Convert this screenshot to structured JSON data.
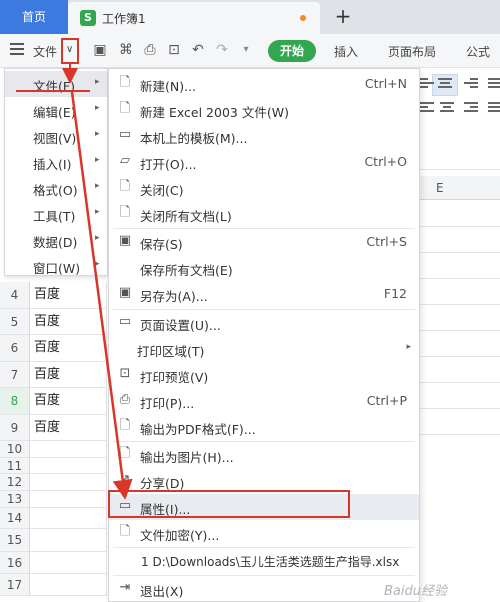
{
  "tabs": {
    "home": "首页",
    "document": "工作簿1",
    "add": "+"
  },
  "toolbar": {
    "file": "文件",
    "start": "开始",
    "insert": "插入",
    "page_layout": "页面布局",
    "formula": "公式"
  },
  "grid": {
    "column_e": "E",
    "rows": [
      {
        "num": "4",
        "value": "百度"
      },
      {
        "num": "5",
        "value": "百度"
      },
      {
        "num": "6",
        "value": "百度"
      },
      {
        "num": "7",
        "value": "百度"
      },
      {
        "num": "8",
        "value": "百度"
      },
      {
        "num": "9",
        "value": "百度"
      },
      {
        "num": "10",
        "value": ""
      },
      {
        "num": "11",
        "value": ""
      },
      {
        "num": "12",
        "value": ""
      },
      {
        "num": "13",
        "value": ""
      },
      {
        "num": "14",
        "value": ""
      },
      {
        "num": "15",
        "value": ""
      },
      {
        "num": "16",
        "value": ""
      },
      {
        "num": "17",
        "value": ""
      }
    ]
  },
  "left_menu": [
    {
      "label": "文件(F)"
    },
    {
      "label": "编辑(E)"
    },
    {
      "label": "视图(V)"
    },
    {
      "label": "插入(I)"
    },
    {
      "label": "格式(O)"
    },
    {
      "label": "工具(T)"
    },
    {
      "label": "数据(D)"
    },
    {
      "label": "窗口(W)"
    }
  ],
  "file_menu": [
    {
      "label": "新建(N)...",
      "shortcut": "Ctrl+N",
      "icon": "new-doc-icon"
    },
    {
      "label": "新建 Excel 2003 文件(W)",
      "shortcut": "",
      "icon": "new-excel-icon"
    },
    {
      "label": "本机上的模板(M)...",
      "shortcut": "",
      "icon": "template-icon"
    },
    {
      "label": "打开(O)...",
      "shortcut": "Ctrl+O",
      "icon": "folder-icon"
    },
    {
      "label": "关闭(C)",
      "shortcut": "",
      "icon": "close-doc-icon"
    },
    {
      "label": "关闭所有文档(L)",
      "shortcut": "",
      "icon": "close-all-icon"
    },
    {
      "label": "保存(S)",
      "shortcut": "Ctrl+S",
      "icon": "save-icon"
    },
    {
      "label": "保存所有文档(E)",
      "shortcut": "",
      "icon": ""
    },
    {
      "label": "另存为(A)...",
      "shortcut": "F12",
      "icon": "save-as-icon"
    },
    {
      "label": "页面设置(U)...",
      "shortcut": "",
      "icon": "page-setup-icon"
    },
    {
      "label": "打印区域(T)",
      "shortcut": "",
      "icon": ""
    },
    {
      "label": "打印预览(V)",
      "shortcut": "",
      "icon": "print-preview-icon"
    },
    {
      "label": "打印(P)...",
      "shortcut": "Ctrl+P",
      "icon": "printer-icon"
    },
    {
      "label": "输出为PDF格式(F)...",
      "shortcut": "",
      "icon": "pdf-icon"
    },
    {
      "label": "输出为图片(H)...",
      "shortcut": "",
      "icon": "image-export-icon"
    },
    {
      "label": "分享(D)",
      "shortcut": "",
      "icon": "share-icon"
    },
    {
      "label": "属性(I)...",
      "shortcut": "",
      "icon": "properties-icon"
    },
    {
      "label": "文件加密(Y)...",
      "shortcut": "",
      "icon": "encrypt-icon"
    },
    {
      "label": "1 D:\\Downloads\\玉儿生活类选题生产指导.xlsx",
      "shortcut": "",
      "icon": ""
    },
    {
      "label": "退出(X)",
      "shortcut": "",
      "icon": "exit-icon"
    }
  ],
  "watermark": "Baidu经验"
}
